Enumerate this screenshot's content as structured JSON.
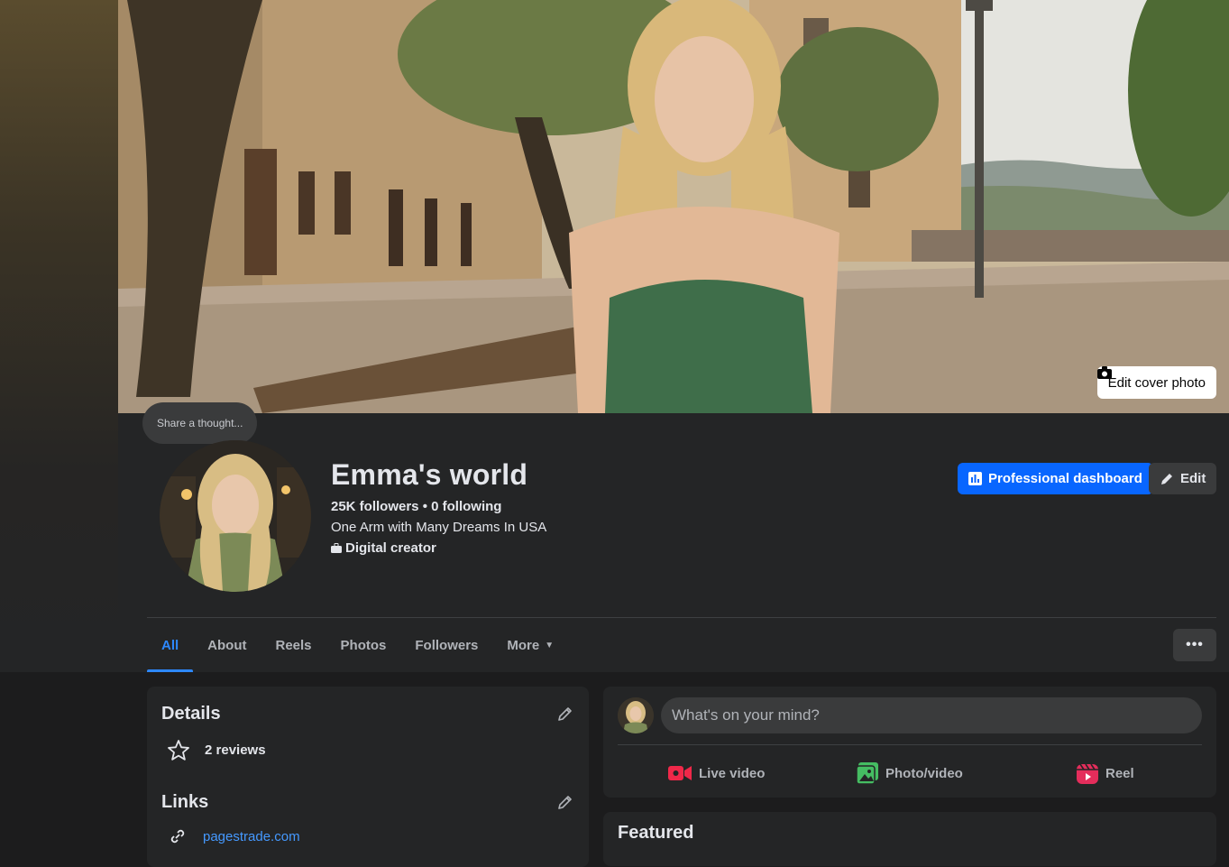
{
  "cover": {
    "edit_cover_label": "Edit cover photo"
  },
  "note": {
    "placeholder_text": "Share a thought..."
  },
  "profile": {
    "name": "Emma's world",
    "follow_line": "25K followers • 0 following",
    "bio": "One Arm with Many Dreams In USA",
    "category": "Digital creator"
  },
  "actions": {
    "professional_dashboard": "Professional dashboard",
    "edit": "Edit"
  },
  "tabs": [
    {
      "label": "All",
      "active": true
    },
    {
      "label": "About"
    },
    {
      "label": "Reels"
    },
    {
      "label": "Photos"
    },
    {
      "label": "Followers"
    },
    {
      "label": "More"
    }
  ],
  "more_menu": {
    "label": "•••"
  },
  "details": {
    "title": "Details",
    "reviews": "2 reviews"
  },
  "links": {
    "title": "Links",
    "items": [
      "pagestrade.com"
    ]
  },
  "composer": {
    "placeholder": "What's on your mind?",
    "live_video": "Live video",
    "photo_video": "Photo/video",
    "reel": "Reel"
  },
  "featured": {
    "title": "Featured"
  },
  "colors": {
    "accent": "#0866ff",
    "link": "#4599ff",
    "live_red": "#f02849",
    "photo_green": "#45bd62",
    "reel_pink": "#e42d5b"
  }
}
